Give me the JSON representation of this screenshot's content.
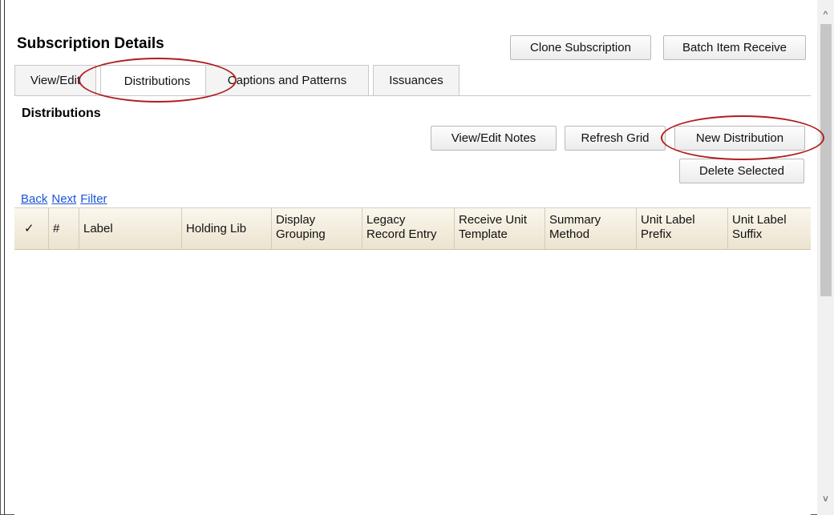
{
  "header": {
    "title": "Subscription Details",
    "clone_label": "Clone Subscription",
    "batch_label": "Batch Item Receive"
  },
  "tabs": [
    {
      "label": "View/Edit"
    },
    {
      "label": "Distributions",
      "active": true
    },
    {
      "label": "Captions and Patterns"
    },
    {
      "label": "Issuances"
    }
  ],
  "section": {
    "title": "Distributions",
    "view_notes_label": "View/Edit Notes",
    "refresh_label": "Refresh Grid",
    "new_label": "New Distribution",
    "delete_label": "Delete Selected"
  },
  "nav_links": {
    "back": "Back",
    "next": "Next",
    "filter": "Filter"
  },
  "grid": {
    "columns": [
      {
        "line1": "✓"
      },
      {
        "line1": "#"
      },
      {
        "line1": "Label"
      },
      {
        "line1": "Holding Lib"
      },
      {
        "line1": "Display",
        "line2": "Grouping"
      },
      {
        "line1": "Legacy",
        "line2": "Record Entry"
      },
      {
        "line1": "Receive Unit",
        "line2": "Template"
      },
      {
        "line1": "Summary",
        "line2": "Method"
      },
      {
        "line1": "Unit Label",
        "line2": "Prefix"
      },
      {
        "line1": "Unit Label",
        "line2": "Suffix"
      }
    ],
    "rows": []
  },
  "scroll": {
    "up_icon": "^",
    "down_icon": "v"
  },
  "colors": {
    "highlight": "#b01e1e",
    "link": "#1a55d8",
    "header_bg": "#f3ecdc"
  }
}
